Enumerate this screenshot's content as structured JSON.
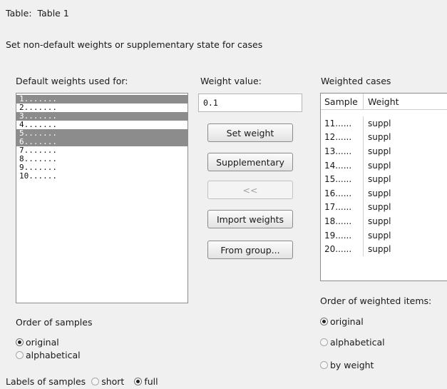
{
  "header": {
    "table_label": "Table:",
    "table_name": "Table 1",
    "subtitle": "Set non-default weights or supplementary state for cases"
  },
  "defaults": {
    "label": "Default weights used for:",
    "items": [
      {
        "label": "1.......",
        "selected": true
      },
      {
        "label": "2.......",
        "selected": false
      },
      {
        "label": "3.......",
        "selected": true
      },
      {
        "label": "4.......",
        "selected": false
      },
      {
        "label": "5.......",
        "selected": true
      },
      {
        "label": "6.......",
        "selected": true
      },
      {
        "label": "7.......",
        "selected": false
      },
      {
        "label": "8.......",
        "selected": false
      },
      {
        "label": "9.......",
        "selected": false
      },
      {
        "label": "10......",
        "selected": false
      }
    ]
  },
  "weight": {
    "label": "Weight value:",
    "value": "0.1"
  },
  "buttons": {
    "set_weight": "Set weight",
    "supplementary": "Supplementary",
    "move_back": "<<",
    "import_weights": "Import weights",
    "from_group": "From group..."
  },
  "weighted": {
    "label": "Weighted cases",
    "columns": [
      "Sample",
      "Weight"
    ],
    "rows": [
      [
        "11......",
        "suppl"
      ],
      [
        "12......",
        "suppl"
      ],
      [
        "13......",
        "suppl"
      ],
      [
        "14......",
        "suppl"
      ],
      [
        "15......",
        "suppl"
      ],
      [
        "16......",
        "suppl"
      ],
      [
        "17......",
        "suppl"
      ],
      [
        "18......",
        "suppl"
      ],
      [
        "19......",
        "suppl"
      ],
      [
        "20......",
        "suppl"
      ]
    ]
  },
  "order_weighted": {
    "label": "Order of weighted items:",
    "options": [
      "original",
      "alphabetical",
      "by weight"
    ],
    "selected": "original"
  },
  "order_samples": {
    "label": "Order of samples",
    "options": [
      "original",
      "alphabetical"
    ],
    "selected": "original"
  },
  "labels": {
    "label": "Labels of samples",
    "options": [
      "short",
      "full"
    ],
    "selected": "full"
  }
}
